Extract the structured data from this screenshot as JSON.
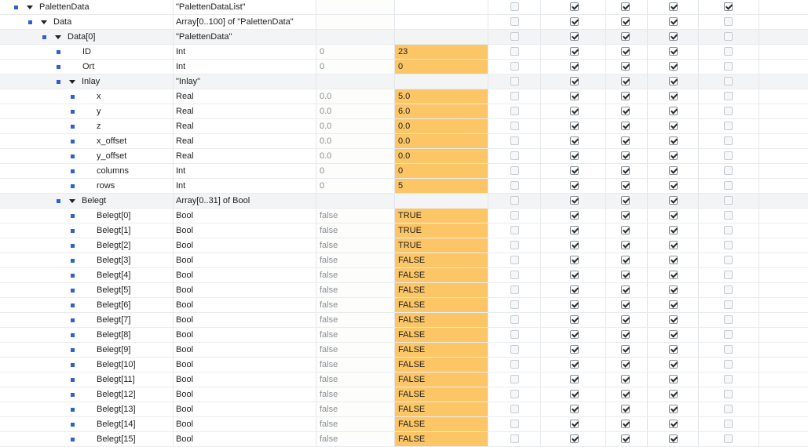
{
  "rows": [
    {
      "name": "PalettenData",
      "type": "\"PalettenDataList\"",
      "start": "",
      "monitor": "",
      "level": 0,
      "expand": true,
      "struct": false,
      "checks": [
        false,
        true,
        true,
        true,
        true
      ]
    },
    {
      "name": "Data",
      "type": "Array[0..100] of \"PalettenData\"",
      "start": "",
      "monitor": "",
      "level": 1,
      "expand": true,
      "struct": false,
      "checks": [
        false,
        true,
        true,
        true,
        false
      ]
    },
    {
      "name": "Data[0]",
      "type": "\"PalettenData\"",
      "start": "",
      "monitor": "",
      "level": 2,
      "expand": true,
      "struct": true,
      "checks": [
        false,
        true,
        true,
        true,
        false
      ]
    },
    {
      "name": "ID",
      "type": "Int",
      "start": "0",
      "monitor": "23",
      "level": 3,
      "expand": false,
      "struct": false,
      "checks": [
        false,
        true,
        true,
        true,
        false
      ]
    },
    {
      "name": "Ort",
      "type": "Int",
      "start": "0",
      "monitor": "0",
      "level": 3,
      "expand": false,
      "struct": false,
      "checks": [
        false,
        true,
        true,
        true,
        false
      ]
    },
    {
      "name": "Inlay",
      "type": "\"Inlay\"",
      "start": "",
      "monitor": "",
      "level": 3,
      "expand": true,
      "struct": true,
      "checks": [
        false,
        true,
        true,
        true,
        false
      ]
    },
    {
      "name": "x",
      "type": "Real",
      "start": "0.0",
      "monitor": "5.0",
      "level": 4,
      "expand": false,
      "struct": false,
      "checks": [
        false,
        true,
        true,
        true,
        false
      ]
    },
    {
      "name": "y",
      "type": "Real",
      "start": "0.0",
      "monitor": "6.0",
      "level": 4,
      "expand": false,
      "struct": false,
      "checks": [
        false,
        true,
        true,
        true,
        false
      ]
    },
    {
      "name": "z",
      "type": "Real",
      "start": "0.0",
      "monitor": "0.0",
      "level": 4,
      "expand": false,
      "struct": false,
      "checks": [
        false,
        true,
        true,
        true,
        false
      ]
    },
    {
      "name": "x_offset",
      "type": "Real",
      "start": "0.0",
      "monitor": "0.0",
      "level": 4,
      "expand": false,
      "struct": false,
      "checks": [
        false,
        true,
        true,
        true,
        false
      ]
    },
    {
      "name": "y_offset",
      "type": "Real",
      "start": "0.0",
      "monitor": "0.0",
      "level": 4,
      "expand": false,
      "struct": false,
      "checks": [
        false,
        true,
        true,
        true,
        false
      ]
    },
    {
      "name": "columns",
      "type": "Int",
      "start": "0",
      "monitor": "0",
      "level": 4,
      "expand": false,
      "struct": false,
      "checks": [
        false,
        true,
        true,
        true,
        false
      ]
    },
    {
      "name": "rows",
      "type": "Int",
      "start": "0",
      "monitor": "5",
      "level": 4,
      "expand": false,
      "struct": false,
      "checks": [
        false,
        true,
        true,
        true,
        false
      ]
    },
    {
      "name": "Belegt",
      "type": "Array[0..31] of Bool",
      "start": "",
      "monitor": "",
      "level": 3,
      "expand": true,
      "struct": true,
      "checks": [
        false,
        true,
        true,
        true,
        false
      ]
    },
    {
      "name": "Belegt[0]",
      "type": "Bool",
      "start": "false",
      "monitor": "TRUE",
      "level": 4,
      "expand": false,
      "struct": false,
      "checks": [
        false,
        true,
        true,
        true,
        false
      ]
    },
    {
      "name": "Belegt[1]",
      "type": "Bool",
      "start": "false",
      "monitor": "TRUE",
      "level": 4,
      "expand": false,
      "struct": false,
      "checks": [
        false,
        true,
        true,
        true,
        false
      ]
    },
    {
      "name": "Belegt[2]",
      "type": "Bool",
      "start": "false",
      "monitor": "TRUE",
      "level": 4,
      "expand": false,
      "struct": false,
      "checks": [
        false,
        true,
        true,
        true,
        false
      ]
    },
    {
      "name": "Belegt[3]",
      "type": "Bool",
      "start": "false",
      "monitor": "FALSE",
      "level": 4,
      "expand": false,
      "struct": false,
      "checks": [
        false,
        true,
        true,
        true,
        false
      ]
    },
    {
      "name": "Belegt[4]",
      "type": "Bool",
      "start": "false",
      "monitor": "FALSE",
      "level": 4,
      "expand": false,
      "struct": false,
      "checks": [
        false,
        true,
        true,
        true,
        false
      ]
    },
    {
      "name": "Belegt[5]",
      "type": "Bool",
      "start": "false",
      "monitor": "FALSE",
      "level": 4,
      "expand": false,
      "struct": false,
      "checks": [
        false,
        true,
        true,
        true,
        false
      ]
    },
    {
      "name": "Belegt[6]",
      "type": "Bool",
      "start": "false",
      "monitor": "FALSE",
      "level": 4,
      "expand": false,
      "struct": false,
      "checks": [
        false,
        true,
        true,
        true,
        false
      ]
    },
    {
      "name": "Belegt[7]",
      "type": "Bool",
      "start": "false",
      "monitor": "FALSE",
      "level": 4,
      "expand": false,
      "struct": false,
      "checks": [
        false,
        true,
        true,
        true,
        false
      ]
    },
    {
      "name": "Belegt[8]",
      "type": "Bool",
      "start": "false",
      "monitor": "FALSE",
      "level": 4,
      "expand": false,
      "struct": false,
      "checks": [
        false,
        true,
        true,
        true,
        false
      ]
    },
    {
      "name": "Belegt[9]",
      "type": "Bool",
      "start": "false",
      "monitor": "FALSE",
      "level": 4,
      "expand": false,
      "struct": false,
      "checks": [
        false,
        true,
        true,
        true,
        false
      ]
    },
    {
      "name": "Belegt[10]",
      "type": "Bool",
      "start": "false",
      "monitor": "FALSE",
      "level": 4,
      "expand": false,
      "struct": false,
      "checks": [
        false,
        true,
        true,
        true,
        false
      ]
    },
    {
      "name": "Belegt[11]",
      "type": "Bool",
      "start": "false",
      "monitor": "FALSE",
      "level": 4,
      "expand": false,
      "struct": false,
      "checks": [
        false,
        true,
        true,
        true,
        false
      ]
    },
    {
      "name": "Belegt[12]",
      "type": "Bool",
      "start": "false",
      "monitor": "FALSE",
      "level": 4,
      "expand": false,
      "struct": false,
      "checks": [
        false,
        true,
        true,
        true,
        false
      ]
    },
    {
      "name": "Belegt[13]",
      "type": "Bool",
      "start": "false",
      "monitor": "FALSE",
      "level": 4,
      "expand": false,
      "struct": false,
      "checks": [
        false,
        true,
        true,
        true,
        false
      ]
    },
    {
      "name": "Belegt[14]",
      "type": "Bool",
      "start": "false",
      "monitor": "FALSE",
      "level": 4,
      "expand": false,
      "struct": false,
      "checks": [
        false,
        true,
        true,
        true,
        false
      ]
    },
    {
      "name": "Belegt[15]",
      "type": "Bool",
      "start": "false",
      "monitor": "FALSE",
      "level": 4,
      "expand": false,
      "struct": false,
      "checks": [
        false,
        true,
        true,
        true,
        false
      ]
    }
  ],
  "colors": {
    "monitor_value_bg": "#fcc667",
    "member_bullet": "#2f5fd0",
    "struct_row_bg": "#f3f4f5"
  },
  "icons": {
    "member": "member-bullet-icon",
    "expand": "expand-triangle-icon",
    "checkbox": "checkbox-icon"
  }
}
